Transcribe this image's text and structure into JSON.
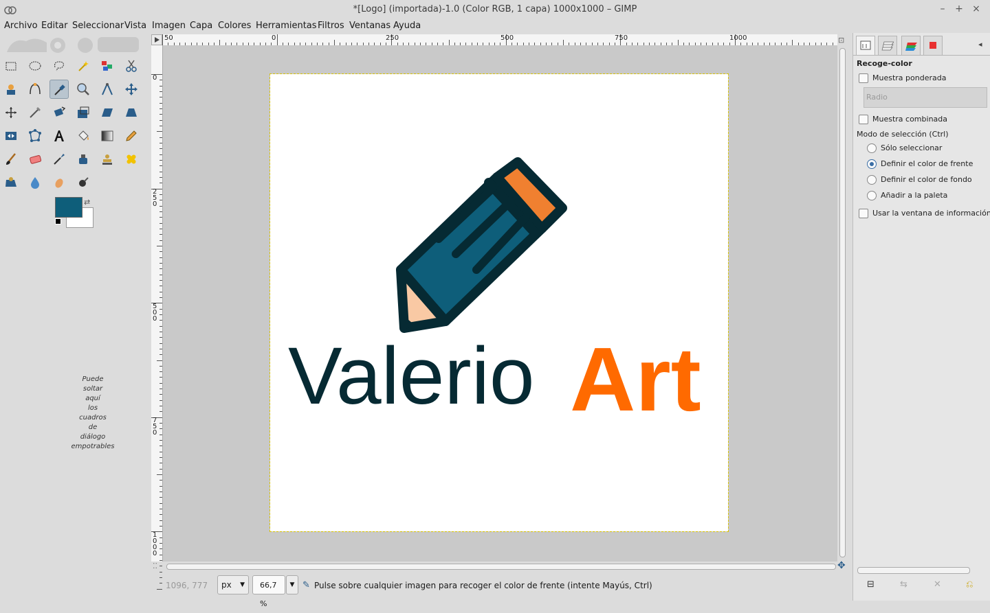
{
  "window": {
    "title": "*[Logo] (importada)-1.0 (Color RGB, 1 capa) 1000x1000 – GIMP",
    "controls": [
      "–",
      "+",
      "×"
    ]
  },
  "menu": [
    "Archivo",
    "Editar",
    "Seleccionar",
    "Vista",
    "Imagen",
    "Capa",
    "Colores",
    "Herramientas",
    "Filtros",
    "Ventanas",
    "Ayuda"
  ],
  "toolbox": {
    "tools": [
      "rect-select",
      "ellipse-select",
      "free-select",
      "fuzzy-select",
      "select-by-color",
      "scissors-select",
      "foreground-select",
      "paths",
      "color-picker",
      "zoom",
      "measure",
      "move",
      "align",
      "crop",
      "rotate",
      "scale",
      "shear",
      "perspective",
      "flip",
      "cage-transform",
      "warp-transform",
      "text",
      "bucket-fill",
      "blend",
      "pencil",
      "paintbrush",
      "eraser",
      "airbrush",
      "ink",
      "clone",
      "heal",
      "perspective-clone",
      "blur-sharpen",
      "smudge",
      "dodge-burn"
    ],
    "active_tool": "color-picker",
    "foreground_color": "#0e5e7a",
    "background_color": "#ffffff",
    "drop_hint": [
      "Puede",
      "soltar",
      "aquí",
      "los",
      "cuadros",
      "de",
      "diálogo",
      "empotrables"
    ]
  },
  "rulers": {
    "h_labels": [
      "50",
      "0",
      "250",
      "500",
      "750",
      "1000"
    ],
    "v_labels": [
      "0",
      "250",
      "500",
      "750",
      "1000"
    ]
  },
  "image": {
    "logo_word1": "Valerio",
    "logo_word2": "Art",
    "word1_color": "#062a33",
    "word2_color": "#ff6a00"
  },
  "status": {
    "coords": "1096, 777",
    "unit": "px",
    "zoom": "66,7 %",
    "hint": "Pulse sobre cualquier imagen para recoger el color de frente (intente Mayús, Ctrl)"
  },
  "tool_options": {
    "title": "Recoge-color",
    "sample_average": "Muestra ponderada",
    "radius_placeholder": "Radio",
    "sample_merged": "Muestra combinada",
    "mode_label": "Modo de selección  (Ctrl)",
    "modes": [
      "Sólo seleccionar",
      "Definir el color de frente",
      "Definir el color de fondo",
      "Añadir a la paleta"
    ],
    "selected_mode": "Definir el color de frente",
    "info_window": "Usar la ventana de información  (M"
  }
}
